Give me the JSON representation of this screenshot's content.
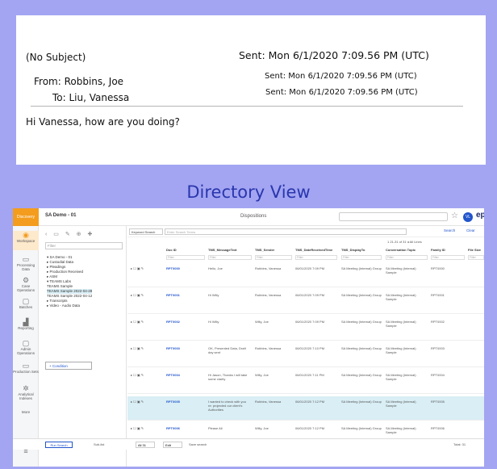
{
  "email": {
    "subject": "(No Subject)",
    "sent_main": "Sent:   Mon 6/1/2020 7:09.56 PM (UTC)",
    "from": "From: Robbins, Joe",
    "to": "To: Liu, Vanessa",
    "sent_2": "Sent:   Mon 6/1/2020 7:09.56 PM (UTC)",
    "sent_3": "Sent: Mon 6/1/2020 7:09.56 PM (UTC)",
    "greeting": "Hi Vanessa, how are you doing?"
  },
  "section_title": "Directory View",
  "app": {
    "logo": "Discovery",
    "workspace": "SA Demo - 01",
    "disposition": "Dispositions",
    "avatar": "VL",
    "brand": "epiq",
    "nav": [
      "Workspace",
      "Processing Data",
      "Case Operations",
      "Batches",
      "Reporting",
      "Admin Operations",
      "Production Sets",
      "Analytical Indexes",
      "More"
    ],
    "folder_filter_placeholder": "Filter",
    "folders": [
      "▾ SA Demo - 01",
      "  ▸ Custodial Data",
      "  ▸ Pleadings",
      "  ▸ Production Received",
      "  ▸ ASM",
      "  ▾ TEAMS Labs",
      "      TEAMS Sample",
      "      TEAMS Sample 2022-04-28",
      "      TEAMS Sample 2022-04-12",
      "  ▸ Transcripts",
      "  ▸ Video - Audio Data"
    ],
    "condition_label": "+ Condition",
    "keyword_label": "Keyword Search",
    "keyword_placeholder": "Enter Search Terms",
    "search_label": "Search",
    "clear_label": "Clear",
    "pager": "1  21-31 of 31  ◂  All Lines",
    "columns": [
      "Doc ID",
      "TMS_MessageText",
      "TMS_Sender",
      "TMS_DateReceivedTime",
      "TMS_DisplayTo",
      "Conversation Topic",
      "Family ID",
      "File Size"
    ],
    "filters": [
      "Filter",
      "Filter",
      "Filter",
      "Filter",
      "Filter",
      "Filter",
      "Filter",
      "Filter"
    ],
    "rows": [
      [
        "RPT0000",
        "Hello, Joe",
        "Robbins, Vanessa",
        "06/01/2020 7:09 PM",
        "SA Meeting (Internal) Group",
        "SA Meeting (Internal) Sample",
        "RPT0000",
        ""
      ],
      [
        "RPT0001",
        "Hi Willy",
        "Robbins, Vanessa",
        "06/01/2020 7:09 PM",
        "SA Meeting (Internal) Group",
        "SA Meeting (Internal) Sample",
        "RPT0001",
        ""
      ],
      [
        "RPT0002",
        "Hi Willy",
        "Willy, Joe",
        "06/01/2020 7:09 PM",
        "SA Meeting (Internal) Group",
        "SA Meeting (Internal) Sample",
        "RPT0002",
        ""
      ],
      [
        "RPT0003",
        "OK, Presented Data, Draft day sent",
        "Robbins, Vanessa",
        "06/01/2020 7:10 PM",
        "SA Meeting (Internal) Group",
        "SA Meeting (Internal) Sample",
        "RPT0003",
        ""
      ],
      [
        "RPT0004",
        "Hi Jason, Thanks I will take some clarity",
        "Willy, Joe",
        "06/01/2020 7:11 PM",
        "SA Meeting (Internal) Group",
        "SA Meeting (Internal) Sample",
        "RPT0004",
        ""
      ],
      [
        "RPT0005",
        "I wanted to check with you re: projected our client's Authorities",
        "Robbins, Vanessa",
        "06/01/2020 7:12 PM",
        "SA Meeting (Internal) Group",
        "SA Meeting (Internal) Sample",
        "RPT0005",
        ""
      ],
      [
        "RPT0006",
        "Please All",
        "Willy, Joe",
        "06/01/2020 7:12 PM",
        "SA Meeting (Internal) Group",
        "SA Meeting (Internal) Sample",
        "RPT0006",
        ""
      ]
    ],
    "bottom": {
      "run_search": "Run Search",
      "sub_list": "Sub-list",
      "file": "All 31",
      "edit": "Edit",
      "save": "Save search",
      "total": "Total: 31"
    }
  }
}
